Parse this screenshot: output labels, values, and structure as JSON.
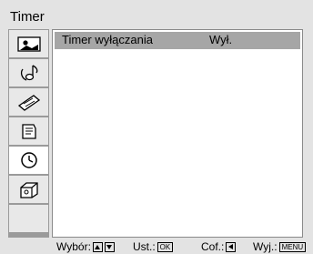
{
  "header": {
    "title": "Timer"
  },
  "sidebar": {
    "items": [
      {
        "icon": "picture-icon"
      },
      {
        "icon": "sound-icon"
      },
      {
        "icon": "screen-icon"
      },
      {
        "icon": "channel-setup-icon"
      },
      {
        "icon": "timer-icon",
        "active": true
      },
      {
        "icon": "setup-icon"
      },
      {
        "icon": "blank"
      }
    ]
  },
  "menu": {
    "items": [
      {
        "label": "Timer wyłączania",
        "value": "Wył."
      }
    ]
  },
  "footer": {
    "select_label": "Wybór:",
    "set_label": "Ust.:",
    "set_key": "OK",
    "back_label": "Cof.:",
    "exit_label": "Wyj.:",
    "exit_key": "MENU"
  }
}
